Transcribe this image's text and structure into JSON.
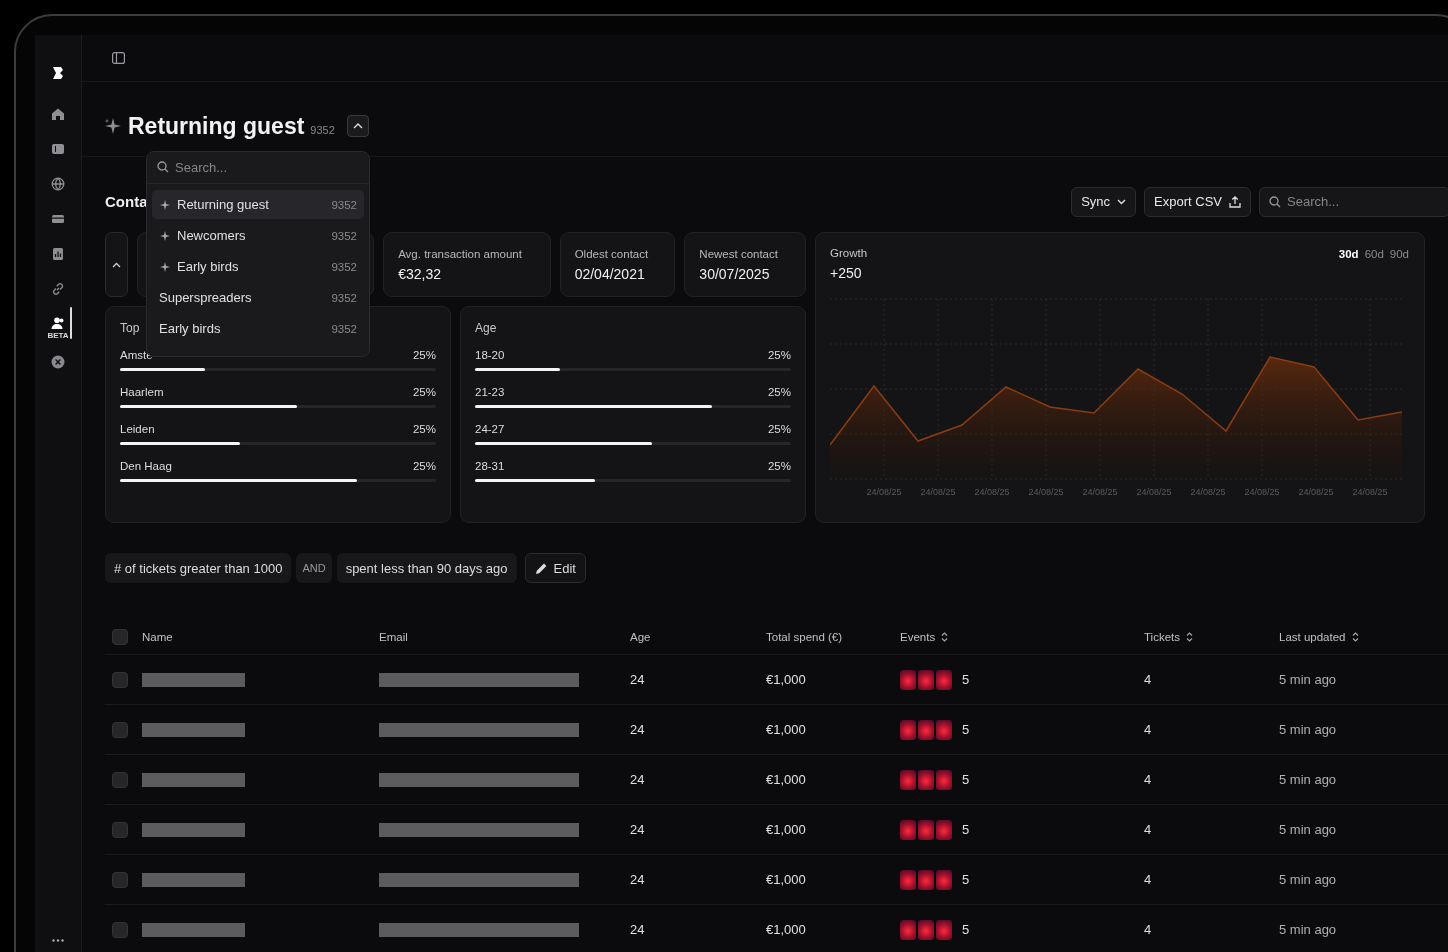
{
  "sidebar": {
    "items": [
      {
        "kind": "home",
        "selected": false
      },
      {
        "kind": "list",
        "selected": false
      },
      {
        "kind": "globe",
        "selected": false
      },
      {
        "kind": "card",
        "selected": false
      },
      {
        "kind": "chart",
        "selected": false
      },
      {
        "kind": "link",
        "selected": false
      },
      {
        "kind": "contacts",
        "selected": true,
        "badge": "BETA"
      },
      {
        "kind": "close",
        "selected": false
      }
    ]
  },
  "segment": {
    "title": "Returning guest",
    "count": "9352",
    "expanded": true
  },
  "dropdown": {
    "placeholder": "Search...",
    "items": [
      {
        "label": "Returning guest",
        "count": "9352",
        "sparkle": true,
        "selected": true
      },
      {
        "label": "Newcomers",
        "count": "9352",
        "sparkle": true,
        "selected": false
      },
      {
        "label": "Early birds",
        "count": "9352",
        "sparkle": true,
        "selected": false
      },
      {
        "label": "Superspreaders",
        "count": "9352",
        "sparkle": false,
        "selected": false
      },
      {
        "label": "Early birds",
        "count": "9352",
        "sparkle": false,
        "selected": false
      }
    ]
  },
  "section_title": "Conta",
  "toolbar": {
    "sync": "Sync",
    "export": "Export CSV",
    "search_placeholder": "Search..."
  },
  "stats": [
    {
      "label": "Avg. transaction amount",
      "value": "€32,32"
    },
    {
      "label": "Oldest contact",
      "value": "02/04/2021"
    },
    {
      "label": "Newest contact",
      "value": "30/07/2025"
    }
  ],
  "growth": {
    "label": "Growth",
    "value": "+250",
    "ranges": [
      {
        "label": "30d",
        "selected": true
      },
      {
        "label": "60d",
        "selected": false
      },
      {
        "label": "90d",
        "selected": false
      }
    ],
    "x_labels": [
      "24/08/25",
      "24/08/25",
      "24/08/25",
      "24/08/25",
      "24/08/25",
      "24/08/25",
      "24/08/25",
      "24/08/25",
      "24/08/25",
      "24/08/25"
    ]
  },
  "cities": {
    "title": "Top",
    "rows": [
      {
        "label": "Amste",
        "value": "25%",
        "level": 0.27
      },
      {
        "label": "Haarlem",
        "value": "25%",
        "level": 0.56
      },
      {
        "label": "Leiden",
        "value": "25%",
        "level": 0.38
      },
      {
        "label": "Den Haag",
        "value": "25%",
        "level": 0.75
      }
    ]
  },
  "age": {
    "title": "Age",
    "rows": [
      {
        "label": "18-20",
        "value": "25%",
        "level": 0.27
      },
      {
        "label": "21-23",
        "value": "25%",
        "level": 0.75
      },
      {
        "label": "24-27",
        "value": "25%",
        "level": 0.56
      },
      {
        "label": "28-31",
        "value": "25%",
        "level": 0.38
      }
    ]
  },
  "filters": [
    {
      "kind": "condition",
      "text": "# of tickets greater than 1000"
    },
    {
      "kind": "operator",
      "text": "AND"
    },
    {
      "kind": "condition",
      "text": "spent less than 90 days ago"
    }
  ],
  "edit_button": "Edit",
  "table": {
    "all_checked": false,
    "columns": [
      {
        "label": "Name",
        "sortable": false
      },
      {
        "label": "Email",
        "sortable": false
      },
      {
        "label": "Age",
        "sortable": false
      },
      {
        "label": "Total spend (€)",
        "sortable": false
      },
      {
        "label": "Events",
        "sortable": true
      },
      {
        "label": "Tickets",
        "sortable": true
      },
      {
        "label": "Last updated",
        "sortable": true
      }
    ],
    "rows": [
      {
        "checked": false,
        "age": "24",
        "total": "€1,000",
        "events": "5",
        "tickets": "4",
        "updated": "5 min ago"
      },
      {
        "checked": false,
        "age": "24",
        "total": "€1,000",
        "events": "5",
        "tickets": "4",
        "updated": "5 min ago"
      },
      {
        "checked": false,
        "age": "24",
        "total": "€1,000",
        "events": "5",
        "tickets": "4",
        "updated": "5 min ago"
      },
      {
        "checked": false,
        "age": "24",
        "total": "€1,000",
        "events": "5",
        "tickets": "4",
        "updated": "5 min ago"
      },
      {
        "checked": false,
        "age": "24",
        "total": "€1,000",
        "events": "5",
        "tickets": "4",
        "updated": "5 min ago"
      },
      {
        "checked": false,
        "age": "24",
        "total": "€1,000",
        "events": "5",
        "tickets": "4",
        "updated": "5 min ago"
      }
    ]
  }
}
